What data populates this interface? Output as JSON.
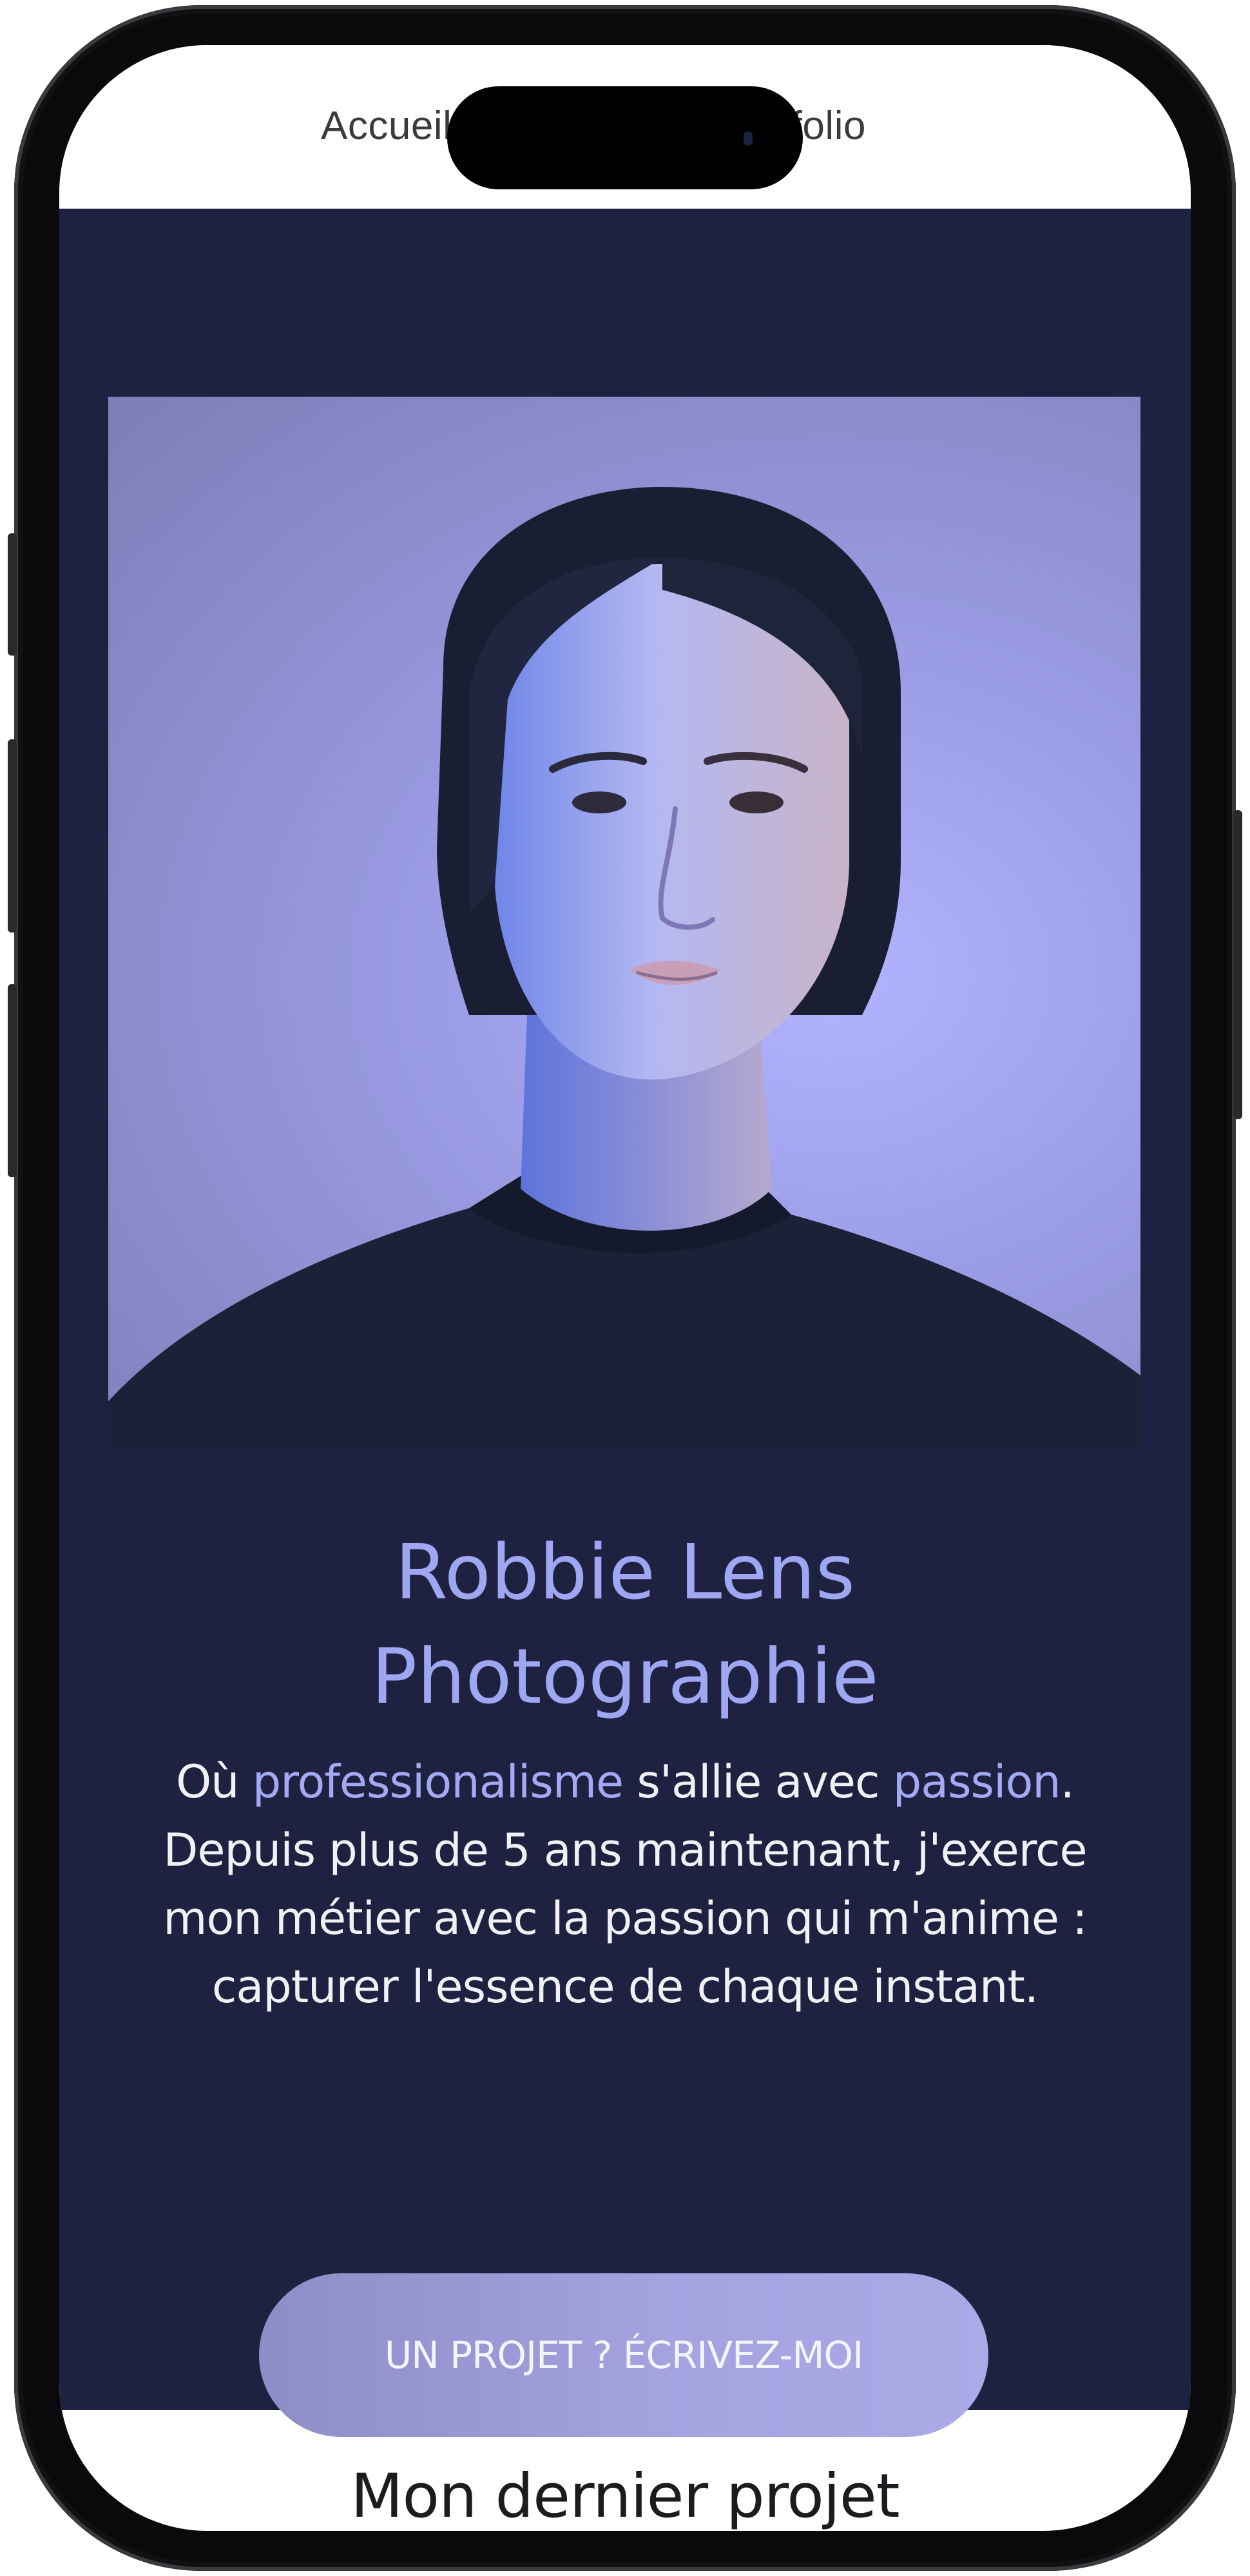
{
  "nav": {
    "items": [
      {
        "label": "Accueil"
      },
      {
        "label": "Portfolio"
      }
    ]
  },
  "hero": {
    "title_line1": "Robbie Lens",
    "title_line2": "Photographie",
    "description": {
      "part1": "Où ",
      "highlight1": "professionalisme",
      "part2": " s'allie avec ",
      "highlight2": "passion",
      "part3": ". Depuis plus de 5 ans maintenant, j'exerce mon métier avec la passion qui m'anime : capturer l'essence de chaque instant."
    },
    "cta_label": "UN PROJET ? ÉCRIVEZ-MOI"
  },
  "latest_project": {
    "title": "Mon dernier projet"
  },
  "colors": {
    "hero_background": "#1e2140",
    "accent": "#9fa6f2",
    "button": "#a4a2df"
  },
  "icons": [
    "portrait-photo"
  ]
}
